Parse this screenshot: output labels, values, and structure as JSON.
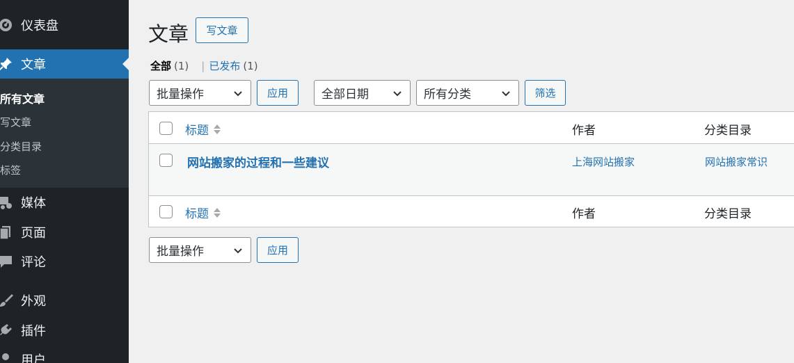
{
  "sidebar": {
    "items": [
      {
        "label": "仪表盘",
        "icon": "dashboard-icon"
      },
      {
        "label": "文章",
        "icon": "pin-icon",
        "active": true
      },
      {
        "label": "媒体",
        "icon": "media-icon"
      },
      {
        "label": "页面",
        "icon": "page-icon"
      },
      {
        "label": "评论",
        "icon": "comment-icon"
      },
      {
        "label": "外观",
        "icon": "brush-icon"
      },
      {
        "label": "插件",
        "icon": "plugin-icon"
      },
      {
        "label": "用户",
        "icon": "user-icon"
      }
    ],
    "submenu": [
      {
        "label": "所有文章",
        "current": true
      },
      {
        "label": "写文章"
      },
      {
        "label": "分类目录"
      },
      {
        "label": "标签"
      }
    ]
  },
  "main": {
    "title": "文章",
    "add_new": "写文章",
    "filters": {
      "all_label": "全部",
      "all_count": "(1)",
      "separator": "|",
      "published_label": "已发布",
      "published_count": "(1)"
    },
    "bulk_action": "批量操作",
    "apply": "应用",
    "date_filter": "全部日期",
    "category_filter": "所有分类",
    "filter_button": "筛选"
  },
  "table": {
    "columns": {
      "title": "标题",
      "author": "作者",
      "categories": "分类目录"
    },
    "rows": [
      {
        "title": "网站搬家的过程和一些建议",
        "author": "上海网站搬家",
        "category": "网站搬家常识"
      }
    ]
  },
  "colors": {
    "sidebar_bg": "#1d2327",
    "submenu_bg": "#2c3338",
    "accent": "#2271b1",
    "page_bg": "#f0f0f1"
  }
}
